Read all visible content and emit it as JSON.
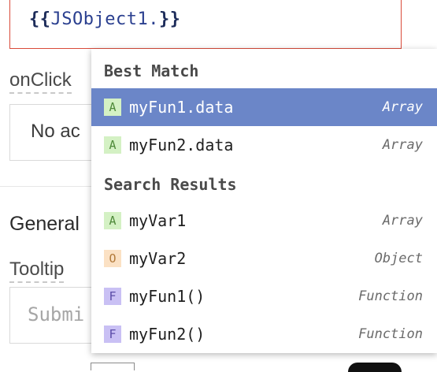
{
  "editor": {
    "open_braces": "{{",
    "expression": "JSObject1.",
    "close_braces": "}}"
  },
  "properties": {
    "onclick_label": "onClick",
    "onclick_value": "No ac",
    "general_section": "General",
    "tooltip_label": "Tooltip",
    "tooltip_placeholder": "Submi"
  },
  "autocomplete": {
    "best_match_header": "Best Match",
    "search_results_header": "Search Results",
    "best_match": [
      {
        "badge": "A",
        "name": "myFun1.data",
        "type": "Array",
        "selected": true
      },
      {
        "badge": "A",
        "name": "myFun2.data",
        "type": "Array",
        "selected": false
      }
    ],
    "search_results": [
      {
        "badge": "A",
        "name": "myVar1",
        "type": "Array"
      },
      {
        "badge": "O",
        "name": "myVar2",
        "type": "Object"
      },
      {
        "badge": "F",
        "name": "myFun1()",
        "type": "Function"
      },
      {
        "badge": "F",
        "name": "myFun2()",
        "type": "Function"
      }
    ]
  },
  "colors": {
    "selected_bg": "#6b86c8",
    "editor_error_border": "#d94a3a",
    "array_badge": "#d4f1c4",
    "object_badge": "#fbe1c4",
    "function_badge": "#c9c0f4"
  }
}
